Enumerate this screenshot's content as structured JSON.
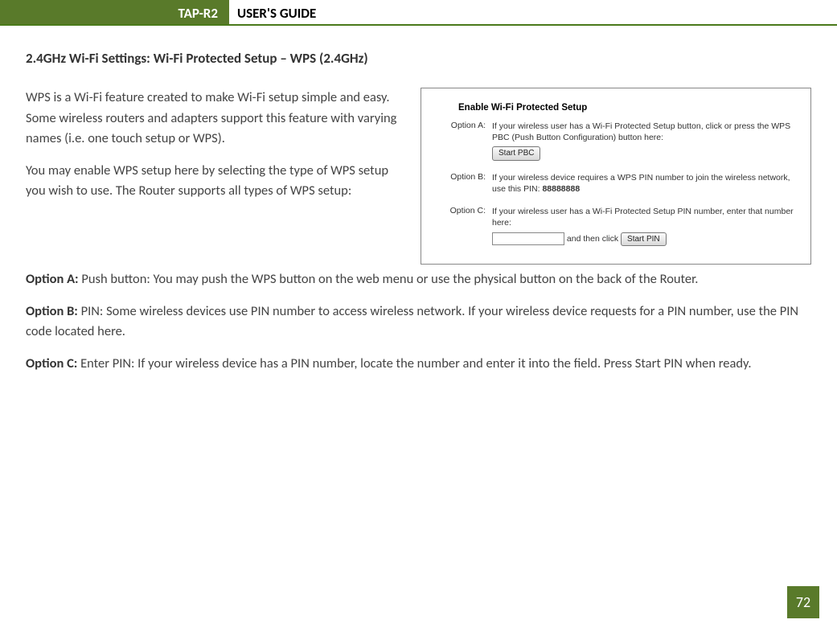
{
  "header": {
    "product": "TAP-R2",
    "title": "USER'S GUIDE"
  },
  "section_title": "2.4GHz Wi-Fi Settings: Wi-Fi Protected Setup – WPS (2.4GHz)",
  "intro_para1": "WPS is a Wi-Fi feature created to make Wi-Fi setup simple and easy.  Some wireless routers and adapters support this feature with varying names (i.e. one touch setup or WPS).",
  "intro_para2": "You may enable WPS setup here by selecting the type of WPS setup you wish to use.  The Router supports all types of WPS setup:",
  "option_a": {
    "label": "Option A:",
    "text": " Push button: You may push the WPS button on the web menu or use the physical button on the back of the Router."
  },
  "option_b": {
    "label": "Option B:",
    "text": " PIN: Some wireless devices use PIN number to access wireless network.  If your wireless device requests for a PIN number, use the PIN code located here."
  },
  "option_c": {
    "label": "Option C:",
    "text": " Enter PIN: If your wireless device has a PIN number, locate the number and enter it into the field.  Press Start PIN when ready."
  },
  "screenshot": {
    "title": "Enable Wi-Fi Protected Setup",
    "optA": {
      "label": "Option A:",
      "text": "If your wireless user has a Wi-Fi Protected Setup button, click or press the WPS PBC (Push Button Configuration) button here:",
      "btn": "Start PBC"
    },
    "optB": {
      "label": "Option B:",
      "text_prefix": "If your wireless device requires a WPS PIN number to join the wireless network, use this PIN: ",
      "pin": "88888888"
    },
    "optC": {
      "label": "Option C:",
      "text": "If your wireless user has a Wi-Fi Protected Setup PIN number, enter that number here:",
      "and_then": " and then click ",
      "btn": "Start PIN"
    }
  },
  "page_number": "72"
}
